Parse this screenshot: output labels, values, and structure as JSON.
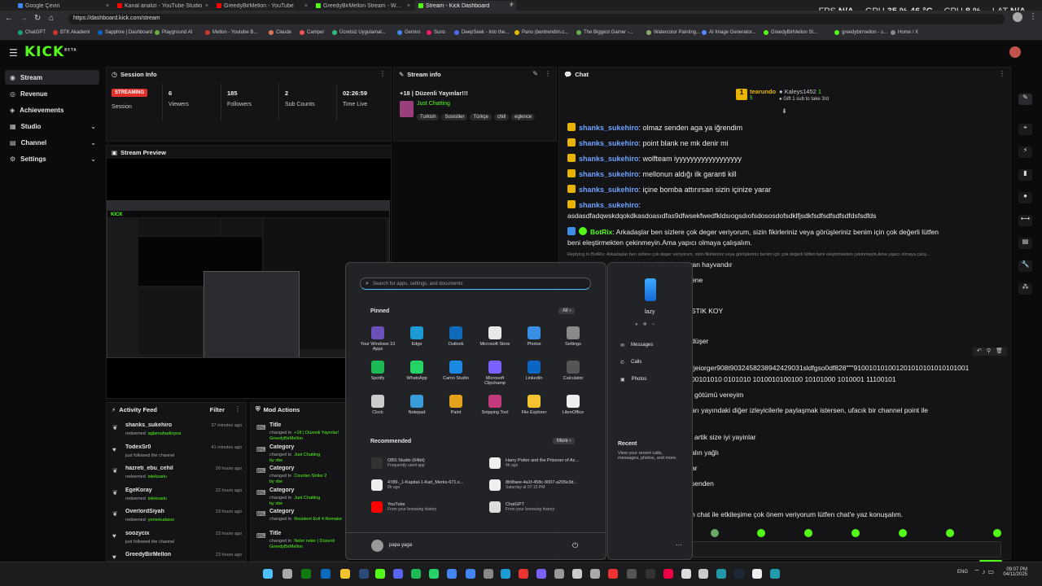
{
  "browser": {
    "tabs": [
      {
        "title": "Google Çeviri",
        "color": "#4285f4"
      },
      {
        "title": "Kanal analizi - YouTube Studio",
        "color": "#ff0000"
      },
      {
        "title": "GreedyBirMellon - YouTube",
        "color": "#ff0000"
      },
      {
        "title": "GreedyBirMellon Stream - Watch...",
        "color": "#53fc18"
      },
      {
        "title": "Stream - Kick Dashboard",
        "color": "#53fc18"
      }
    ],
    "new_tab": "+",
    "url": "https://dashboard.kick.com/stream",
    "bookmarks": [
      "ChatGPT",
      "BTK Akademi",
      "Sapphire | Dashboard",
      "Playground AI",
      "Mellon - Youtube B...",
      "Claude",
      "Camper",
      "Ücretsiz Uygulamal...",
      "Gemini",
      "Suno",
      "DeepSeek - Into the...",
      "Pano (bentrendim.c...",
      "The Biggest Gamer -...",
      "Watercolor Painting...",
      "AI Image Generator...",
      "GreedyBirMellon St...",
      "greedybirmellon - s...",
      "Home / X"
    ]
  },
  "perf": {
    "fps_label": "FPS",
    "fps": "N/A",
    "gpu_label": "GPU",
    "gpu": "35 %",
    "gpu_temp": "46 °C",
    "cpu_label": "CPU",
    "cpu": "8 %",
    "lat_label": "LAT",
    "lat": "N/A"
  },
  "kick": {
    "logo": "KICK",
    "beta": "BETA"
  },
  "sidebar": [
    {
      "label": "Stream",
      "active": true
    },
    {
      "label": "Revenue"
    },
    {
      "label": "Achievements"
    },
    {
      "label": "Studio",
      "chevron": "⌄"
    },
    {
      "label": "Channel",
      "chevron": "⌄"
    },
    {
      "label": "Settings",
      "chevron": "⌄"
    }
  ],
  "session": {
    "title": "Session Info",
    "badge": "STREAMING",
    "badge_label": "Session",
    "viewers": "6",
    "viewers_label": "Viewers",
    "followers": "185",
    "followers_label": "Followers",
    "subs": "2",
    "subs_label": "Sub Counts",
    "time": "02:26:59",
    "time_label": "Time Live"
  },
  "stream_info": {
    "title": "Stream info",
    "stream_title": "+18 | Düzenli Yayınlar!!!",
    "category": "Just Chatting",
    "tags": [
      "Turkish",
      "Sosisliler",
      "Türkçe",
      "chill",
      "eglence"
    ]
  },
  "preview": {
    "title": "Stream Preview"
  },
  "chat": {
    "title": "Chat",
    "top_user": "tearundo",
    "top_count": "5",
    "gifter": "Kaleys1452",
    "gifter_count": "1",
    "gift_text": "Gift 1 sub to take 3rd",
    "messages": [
      {
        "user": "shanks_sukehiro",
        "text": ": olmaz senden aga ya iğrendim"
      },
      {
        "user": "shanks_sukehiro",
        "text": ": point blank ne mk denir mi"
      },
      {
        "user": "shanks_sukehiro",
        "text": ": wolfteam iyyyyyyyyyyyyyyyyyy"
      },
      {
        "user": "shanks_sukehiro",
        "text": ": mellonun aldığı ilk garanti kill"
      },
      {
        "user": "shanks_sukehiro",
        "text": ": içine bomba attırırsan sizin içinize yarar"
      },
      {
        "user": "shanks_sukehiro",
        "text": ":"
      }
    ],
    "long_line": "asdasdfadqwskdqokdkasdoasıdfas9dfwsekfwedfkldsıogsdıofsdososdofsdklfjsdkfsdfsdfsdfsdfdsfsdfds",
    "botrix_user": "BotRix",
    "botrix_text": ": Arkadaşlar ben sizlere çok deger veriyorum, sizin fikirleriniz veya görüşleriniz benim için çok değerli lütfen",
    "botrix_text2": "beni eleştirmekten çekinmeyin.Ama yapıcı olmaya çalışalım.",
    "reply_hint": "Replying to BotRix: Arkadaşlar ben sizlere çok deger veriyorum, sizin fikirleriniz veya görüşleriniz benim için çok değerli lütfen beni eleştirmekten çekinmeyin.Ama yapıcı olmaya çalış...",
    "reply_msg": "tere takla atmayan hayvandır",
    "partials": [
      "ene",
      "STIK KOY",
      "düşer",
      "rjeiorger908t9032458238942429031sldfgso0df828\"\"\"910010101001201010101010101001",
      "00101010 0101010 1010010100100 10101000 1010001 11100101",
      "götümü vereyim",
      "arı yayındaki diğer izleyicilerle paylaşmak istersen, ufacık bir channel point ile",
      "artik size iyi yayinlar",
      "alın yağlı",
      "ar",
      "senden",
      "n chat ile etkileşime çok önem veriyorum lütfen chat'e yaz konuşalım."
    ]
  },
  "activity": {
    "title": "Activity Feed",
    "filter": "Filter",
    "items": [
      {
        "user": "shanks_sukehiro",
        "action": "redeemed",
        "extra": "aglamahadioyna",
        "time": "37 minutes ago"
      },
      {
        "user": "TodexSr0",
        "action": "just followed the channel",
        "extra": "",
        "time": "41 minutes ago"
      },
      {
        "user": "hazreti_ebu_cehil",
        "action": "redeemed",
        "extra": "isteksarkı",
        "time": "20 hours ago"
      },
      {
        "user": "EgeKoray",
        "action": "redeemed",
        "extra": "isteksarkı",
        "time": "22 hours ago"
      },
      {
        "user": "OverlordSiyah",
        "action": "redeemed",
        "extra": "yemekudassi",
        "time": "23 hours ago"
      },
      {
        "user": "soozycix",
        "action": "just followed the channel",
        "extra": "",
        "time": "23 hours ago"
      },
      {
        "user": "GreedyBirMellon",
        "action": "",
        "extra": "",
        "time": "23 hours ago"
      }
    ]
  },
  "mod": {
    "title": "Mod Actions",
    "items": [
      {
        "kind": "Title",
        "pre": "changed to",
        "val": "+18 | Düzenli Yayınlar!",
        "by": "GreedyBirMellon"
      },
      {
        "kind": "Category",
        "pre": "changed to",
        "val": "Just Chatting",
        "by": "by xbe"
      },
      {
        "kind": "Category",
        "pre": "changed to",
        "val": "Counter-Strike 2",
        "by": "by xbe"
      },
      {
        "kind": "Category",
        "pre": "changed to",
        "val": "Just Chatting",
        "by": "by xbe"
      },
      {
        "kind": "Category",
        "pre": "changed to",
        "val": "Resident Evil 4 Remake",
        "by": ""
      },
      {
        "kind": "Title",
        "pre": "changed to",
        "val": "Neler neler | Düzenli",
        "by": "GreedyBirMellon"
      }
    ]
  },
  "startmenu": {
    "search_placeholder": "Search for apps, settings, and documents",
    "pinned": "Pinned",
    "all": "All",
    "apps": [
      {
        "name": "Your Windows 10 Apps",
        "color": "#6b4fbb"
      },
      {
        "name": "Edge",
        "color": "#1e9bd7"
      },
      {
        "name": "Outlook",
        "color": "#0f6cbd"
      },
      {
        "name": "Microsoft Store",
        "color": "#e8e8e8"
      },
      {
        "name": "Photos",
        "color": "#3a8ee6"
      },
      {
        "name": "Settings",
        "color": "#8a8a8a"
      },
      {
        "name": "Spotify",
        "color": "#1db954"
      },
      {
        "name": "WhatsApp",
        "color": "#25d366"
      },
      {
        "name": "Camo Studio",
        "color": "#1e88e5"
      },
      {
        "name": "Microsoft Clipchamp",
        "color": "#7b61ff"
      },
      {
        "name": "LinkedIn",
        "color": "#0a66c2"
      },
      {
        "name": "Calculator",
        "color": "#555"
      },
      {
        "name": "Clock",
        "color": "#ccc"
      },
      {
        "name": "Notepad",
        "color": "#3a9bd9"
      },
      {
        "name": "Paint",
        "color": "#e4a11b"
      },
      {
        "name": "Snipping Tool",
        "color": "#c23b7d"
      },
      {
        "name": "File Explorer",
        "color": "#f4c430"
      },
      {
        "name": "LibreOffice",
        "color": "#eee"
      }
    ],
    "recommended": "Recommended",
    "more": "More",
    "recs": [
      {
        "name": "OBS Studio (64bit)",
        "sub": "Frequently used app",
        "color": "#333"
      },
      {
        "name": "Harry Potter and the Prisoner of Az...",
        "sub": "4h ago",
        "color": "#eee"
      },
      {
        "name": "4789-_1-Kapital-1-Karl_Merks-671.x...",
        "sub": "8h ago",
        "color": "#eee"
      },
      {
        "name": "8b9faee-4a1f-458c-9007-a205e3d...",
        "sub": "Saturday at 07:15 PM",
        "color": "#eee"
      },
      {
        "name": "YouTube",
        "sub": "From your browsing history",
        "color": "#ff0000"
      },
      {
        "name": "ChatGPT",
        "sub": "From your browsing history",
        "color": "#ddd"
      }
    ],
    "user": "papa yaga",
    "power": "⏻"
  },
  "phone": {
    "name": "lazy",
    "items": [
      "Messages",
      "Calls",
      "Photos"
    ],
    "recent_title": "Recent",
    "recent_text": "View your recent calls, messages, photos, and more."
  },
  "clock": {
    "time": "09:07 PM",
    "date": "04/11/2025",
    "lang": "ENG"
  }
}
